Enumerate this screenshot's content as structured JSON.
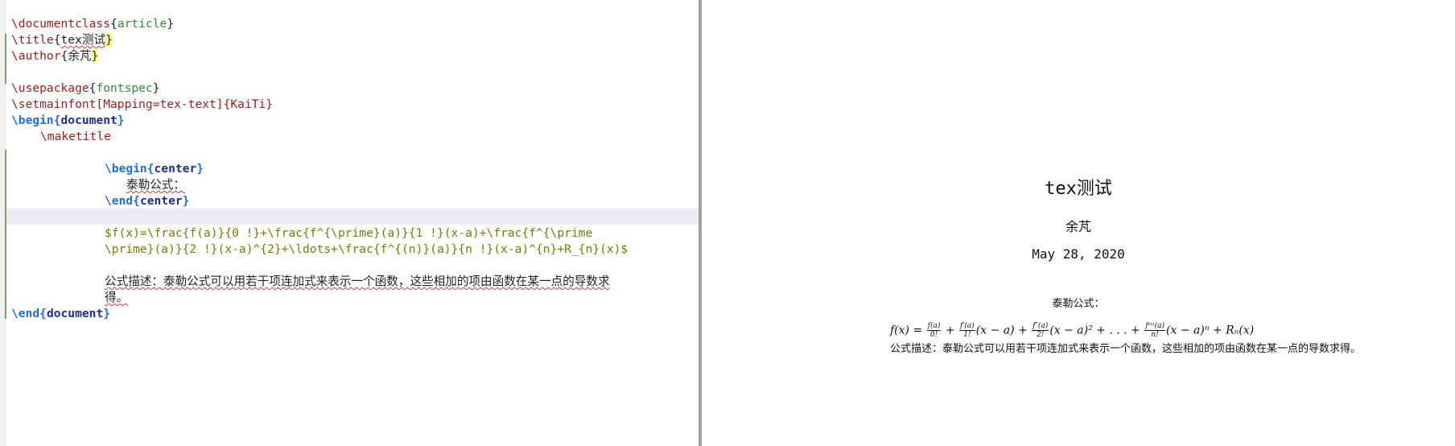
{
  "editor": {
    "lines": {
      "l1_cmd": "\\documentclass",
      "l1_arg": "article",
      "l2_cmd": "\\title",
      "l2_arg": "tex测试",
      "l3_cmd": "\\author",
      "l3_arg": "余芃",
      "l5_cmd": "\\usepackage",
      "l5_arg": "fontspec",
      "l6_text": "\\setmainfont[Mapping=tex-text]{KaiTi}",
      "l7_cmd": "\\begin",
      "l7_env": "document",
      "l8_cmd": "\\maketitle",
      "l10_cmd": "\\begin",
      "l10_env": "center",
      "l11_text": "泰勒公式：",
      "l12_cmd": "\\end",
      "l12_env": "center",
      "l14_text": "$f(x)=\\frac{f(a)}{0 !}+\\frac{f^{\\prime}(a)}{1 !}(x-a)+\\frac{f^{\\prime",
      "l15_text": "\\prime}(a)}{2 !}(x-a)^{2}+\\ldots+\\frac{f^{(n)}(a)}{n !}(x-a)^{n}+R_{n}(x)$",
      "l17_text": "公式描述：泰勒公式可以用若干项连加式来表示一个函数，这些相加的项由函数在某一点的导数求",
      "l18_text": "得。",
      "l19_cmd": "\\end",
      "l19_env": "document"
    }
  },
  "preview": {
    "title": "tex测试",
    "author": "余芃",
    "date": "May 28, 2020",
    "center_text": "泰勒公式：",
    "formula": {
      "f_of_x": "f(x) = ",
      "frac1_num": "f(a)",
      "frac1_den": "0!",
      "plus1": " + ",
      "frac2_num": "f′(a)",
      "frac2_den": "1!",
      "term2": "(x − a) + ",
      "frac3_num": "f″(a)",
      "frac3_den": "2!",
      "term3": "(x − a)² + . . . + ",
      "frac4_num": "f⁽ⁿ⁾(a)",
      "frac4_den": "n!",
      "term4": "(x − a)ⁿ + Rₙ(x)"
    },
    "description": "公式描述：泰勒公式可以用若干项连加式来表示一个函数，这些相加的项由函数在某一点的导数求得。"
  },
  "colors": {
    "command": "#9c1b1b",
    "argument": "#2e8b3a",
    "begin_end": "#1f6fd6",
    "environment": "#1a2f8a",
    "math": "#7a7a00",
    "change_bar": "#6ab04c"
  }
}
